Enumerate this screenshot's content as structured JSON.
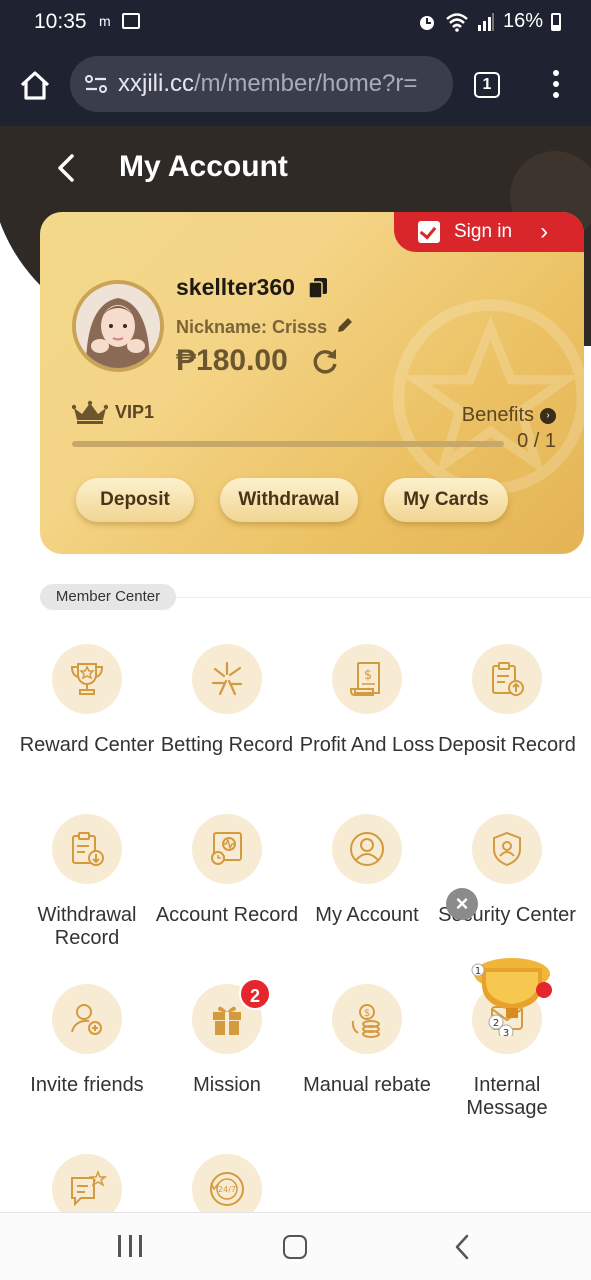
{
  "status_bar": {
    "time": "10:35",
    "m_icon": "m",
    "battery": "16%",
    "icons": [
      "alarm-icon",
      "wifi-icon",
      "signal-icon",
      "battery-icon"
    ]
  },
  "browser": {
    "url_host": "xxjili.cc",
    "url_path": "/m/member/home?r=",
    "tab_count": "1"
  },
  "header": {
    "title": "My Account"
  },
  "account_card": {
    "sign_in_label": "Sign in",
    "username": "skellter360",
    "nickname": "Nickname: Crisss",
    "balance": "₱180.00",
    "vip_level": "VIP1",
    "benefits_label": "Benefits",
    "progress_text": "0 / 1",
    "progress_fraction": 0,
    "buttons": {
      "deposit": "Deposit",
      "withdrawal": "Withdrawal",
      "my_cards": "My Cards"
    }
  },
  "member_center": {
    "section_label": "Member Center",
    "items": [
      {
        "label": "Reward Center",
        "icon": "trophy-icon"
      },
      {
        "label": "Betting Record",
        "icon": "betting-icon"
      },
      {
        "label": "Profit And Loss",
        "icon": "bill-icon"
      },
      {
        "label": "Deposit Record",
        "icon": "clipboard-up-icon"
      },
      {
        "label": "Withdrawal Record",
        "icon": "clipboard-down-icon"
      },
      {
        "label": "Account Record",
        "icon": "account-record-icon"
      },
      {
        "label": "My Account",
        "icon": "user-icon"
      },
      {
        "label": "Security Center",
        "icon": "shield-user-icon"
      },
      {
        "label": "Invite friends",
        "icon": "invite-icon"
      },
      {
        "label": "Mission",
        "icon": "gift-icon",
        "badge": "2"
      },
      {
        "label": "Manual rebate",
        "icon": "rebate-icon"
      },
      {
        "label": "Internal Message",
        "icon": "message-icon"
      },
      {
        "label": "",
        "icon": "feedback-icon"
      },
      {
        "label": "",
        "icon": "support-24-7-icon"
      }
    ]
  },
  "floating": {
    "close_glyph": "×",
    "trophy_numbers": [
      "1",
      "2",
      "3"
    ]
  },
  "colors": {
    "dark_bar": "#1f2331",
    "gold_card": "#f2d283",
    "sign_in_red": "#d8262b",
    "icon_bg": "#f8ebd3",
    "icon_stroke": "#d49a3e"
  }
}
